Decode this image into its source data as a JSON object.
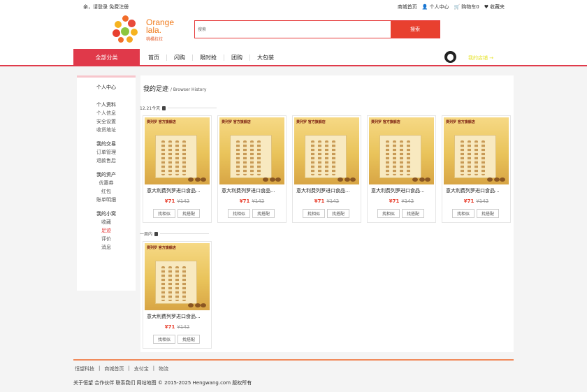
{
  "topbar": {
    "login_prompt": "亲，请登录 免费注册",
    "links": [
      "商城首页",
      "个人中心",
      "购物车0",
      "收藏夹"
    ]
  },
  "logo": {
    "brand_line1": "Orange",
    "brand_line2": "lala.",
    "brand_sub": "桃橘拉拉"
  },
  "search": {
    "placeholder": "搜索",
    "button": "搜索"
  },
  "nav": {
    "all_categories": "全部分类",
    "links": [
      "首页",
      "闪购",
      "限时抢",
      "团购",
      "大包装"
    ],
    "store_link": "我的店铺 →"
  },
  "sidebar": {
    "home": "个人中心",
    "groups": [
      {
        "title": "个人资料",
        "items": [
          "个人信息",
          "安全设置",
          "收货地址"
        ]
      },
      {
        "title": "我的交易",
        "items": [
          "订单管理",
          "退款售后"
        ]
      },
      {
        "title": "我的资产",
        "items": [
          "优惠券",
          "红包",
          "账单明细"
        ]
      },
      {
        "title": "我的小窝",
        "items": [
          "收藏",
          "足迹",
          "评价",
          "消息"
        ]
      }
    ],
    "active_item": "足迹"
  },
  "main": {
    "title": "我的足迹",
    "title_sub": "/ Browser History",
    "sections": [
      {
        "label": "12.21今天"
      },
      {
        "label": "一周内"
      }
    ],
    "product": {
      "badge": "费列罗 官方旗舰店",
      "name": "意大利费列罗进口食品...",
      "price": "¥71",
      "old_price": "¥142",
      "btn_similar": "找相似",
      "btn_match": "找搭配"
    }
  },
  "footer": {
    "links": [
      "恒望科技",
      "商城首页",
      "支付宝",
      "物流"
    ],
    "copyright": "关于恒望 合作伙伴 联系我们 网站地图 © 2015-2025 Hengwang.com 版权所有"
  },
  "colors": {
    "accent": "#e0394a",
    "price": "#e8402f",
    "brand_orange": "#f07a1a"
  }
}
